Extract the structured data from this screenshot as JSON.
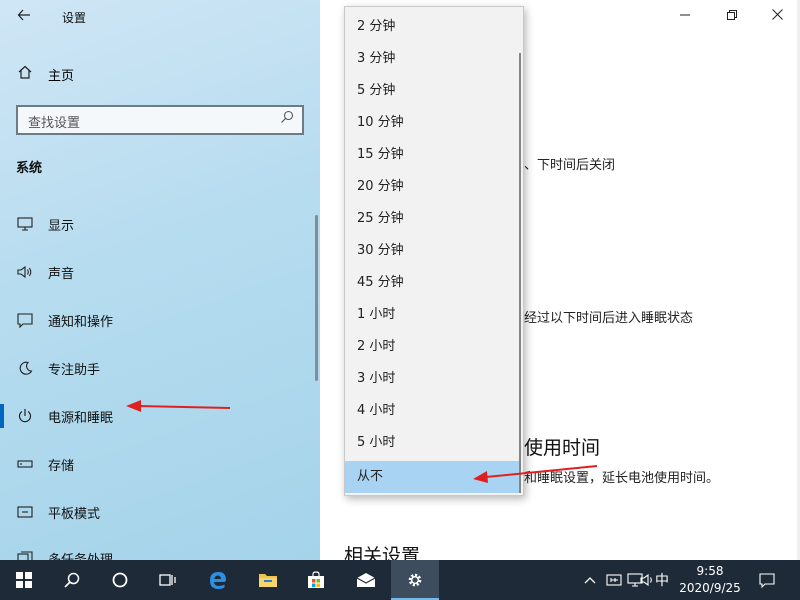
{
  "window": {
    "title": "设置"
  },
  "sidebar": {
    "home_label": "主页",
    "search_placeholder": "查找设置",
    "section_title": "系统",
    "items": [
      {
        "label": "显示",
        "icon": "monitor-icon"
      },
      {
        "label": "声音",
        "icon": "speaker-icon"
      },
      {
        "label": "通知和操作",
        "icon": "message-icon"
      },
      {
        "label": "专注助手",
        "icon": "moon-icon"
      },
      {
        "label": "电源和睡眠",
        "icon": "power-icon"
      },
      {
        "label": "存储",
        "icon": "storage-icon"
      },
      {
        "label": "平板模式",
        "icon": "tablet-icon"
      },
      {
        "label": "多任务处理",
        "icon": "multitask-icon"
      }
    ],
    "active_index": 4
  },
  "main": {
    "screen_partial": "、下时间后关闭",
    "sleep_partial": "经过以下时间后进入睡眠状态",
    "battery_heading_partial": "使用时间",
    "battery_desc_partial": "和睡眠设置，延长电池使用时间。",
    "related_heading_partial": "相关设置"
  },
  "dropdown": {
    "options": [
      "2 分钟",
      "3 分钟",
      "5 分钟",
      "10 分钟",
      "15 分钟",
      "20 分钟",
      "25 分钟",
      "30 分钟",
      "45 分钟",
      "1 小时",
      "2 小时",
      "3 小时",
      "4 小时",
      "5 小时",
      "从不"
    ],
    "selected": "从不"
  },
  "taskbar": {
    "ime": "中",
    "time": "9:58",
    "date": "2020/9/25"
  },
  "colors": {
    "accent": "#0067c0",
    "arrow": "#e02020",
    "selection": "#a9d3f2",
    "taskbar": "#1e2a38"
  }
}
